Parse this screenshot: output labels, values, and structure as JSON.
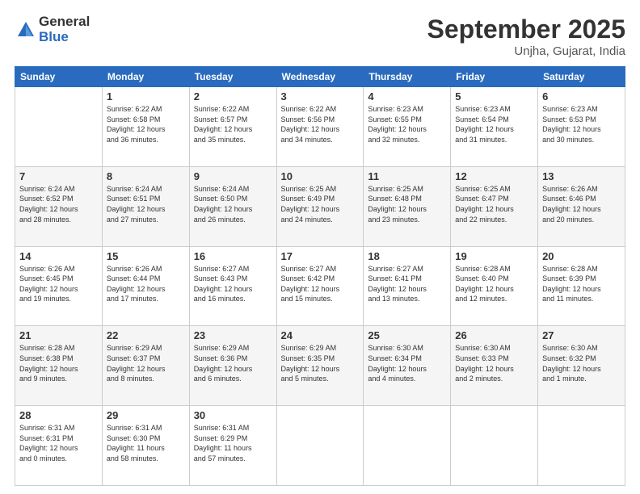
{
  "header": {
    "logo_general": "General",
    "logo_blue": "Blue",
    "month_title": "September 2025",
    "location": "Unjha, Gujarat, India"
  },
  "weekdays": [
    "Sunday",
    "Monday",
    "Tuesday",
    "Wednesday",
    "Thursday",
    "Friday",
    "Saturday"
  ],
  "weeks": [
    [
      {
        "day": "",
        "info": ""
      },
      {
        "day": "1",
        "info": "Sunrise: 6:22 AM\nSunset: 6:58 PM\nDaylight: 12 hours\nand 36 minutes."
      },
      {
        "day": "2",
        "info": "Sunrise: 6:22 AM\nSunset: 6:57 PM\nDaylight: 12 hours\nand 35 minutes."
      },
      {
        "day": "3",
        "info": "Sunrise: 6:22 AM\nSunset: 6:56 PM\nDaylight: 12 hours\nand 34 minutes."
      },
      {
        "day": "4",
        "info": "Sunrise: 6:23 AM\nSunset: 6:55 PM\nDaylight: 12 hours\nand 32 minutes."
      },
      {
        "day": "5",
        "info": "Sunrise: 6:23 AM\nSunset: 6:54 PM\nDaylight: 12 hours\nand 31 minutes."
      },
      {
        "day": "6",
        "info": "Sunrise: 6:23 AM\nSunset: 6:53 PM\nDaylight: 12 hours\nand 30 minutes."
      }
    ],
    [
      {
        "day": "7",
        "info": "Sunrise: 6:24 AM\nSunset: 6:52 PM\nDaylight: 12 hours\nand 28 minutes."
      },
      {
        "day": "8",
        "info": "Sunrise: 6:24 AM\nSunset: 6:51 PM\nDaylight: 12 hours\nand 27 minutes."
      },
      {
        "day": "9",
        "info": "Sunrise: 6:24 AM\nSunset: 6:50 PM\nDaylight: 12 hours\nand 26 minutes."
      },
      {
        "day": "10",
        "info": "Sunrise: 6:25 AM\nSunset: 6:49 PM\nDaylight: 12 hours\nand 24 minutes."
      },
      {
        "day": "11",
        "info": "Sunrise: 6:25 AM\nSunset: 6:48 PM\nDaylight: 12 hours\nand 23 minutes."
      },
      {
        "day": "12",
        "info": "Sunrise: 6:25 AM\nSunset: 6:47 PM\nDaylight: 12 hours\nand 22 minutes."
      },
      {
        "day": "13",
        "info": "Sunrise: 6:26 AM\nSunset: 6:46 PM\nDaylight: 12 hours\nand 20 minutes."
      }
    ],
    [
      {
        "day": "14",
        "info": "Sunrise: 6:26 AM\nSunset: 6:45 PM\nDaylight: 12 hours\nand 19 minutes."
      },
      {
        "day": "15",
        "info": "Sunrise: 6:26 AM\nSunset: 6:44 PM\nDaylight: 12 hours\nand 17 minutes."
      },
      {
        "day": "16",
        "info": "Sunrise: 6:27 AM\nSunset: 6:43 PM\nDaylight: 12 hours\nand 16 minutes."
      },
      {
        "day": "17",
        "info": "Sunrise: 6:27 AM\nSunset: 6:42 PM\nDaylight: 12 hours\nand 15 minutes."
      },
      {
        "day": "18",
        "info": "Sunrise: 6:27 AM\nSunset: 6:41 PM\nDaylight: 12 hours\nand 13 minutes."
      },
      {
        "day": "19",
        "info": "Sunrise: 6:28 AM\nSunset: 6:40 PM\nDaylight: 12 hours\nand 12 minutes."
      },
      {
        "day": "20",
        "info": "Sunrise: 6:28 AM\nSunset: 6:39 PM\nDaylight: 12 hours\nand 11 minutes."
      }
    ],
    [
      {
        "day": "21",
        "info": "Sunrise: 6:28 AM\nSunset: 6:38 PM\nDaylight: 12 hours\nand 9 minutes."
      },
      {
        "day": "22",
        "info": "Sunrise: 6:29 AM\nSunset: 6:37 PM\nDaylight: 12 hours\nand 8 minutes."
      },
      {
        "day": "23",
        "info": "Sunrise: 6:29 AM\nSunset: 6:36 PM\nDaylight: 12 hours\nand 6 minutes."
      },
      {
        "day": "24",
        "info": "Sunrise: 6:29 AM\nSunset: 6:35 PM\nDaylight: 12 hours\nand 5 minutes."
      },
      {
        "day": "25",
        "info": "Sunrise: 6:30 AM\nSunset: 6:34 PM\nDaylight: 12 hours\nand 4 minutes."
      },
      {
        "day": "26",
        "info": "Sunrise: 6:30 AM\nSunset: 6:33 PM\nDaylight: 12 hours\nand 2 minutes."
      },
      {
        "day": "27",
        "info": "Sunrise: 6:30 AM\nSunset: 6:32 PM\nDaylight: 12 hours\nand 1 minute."
      }
    ],
    [
      {
        "day": "28",
        "info": "Sunrise: 6:31 AM\nSunset: 6:31 PM\nDaylight: 12 hours\nand 0 minutes."
      },
      {
        "day": "29",
        "info": "Sunrise: 6:31 AM\nSunset: 6:30 PM\nDaylight: 11 hours\nand 58 minutes."
      },
      {
        "day": "30",
        "info": "Sunrise: 6:31 AM\nSunset: 6:29 PM\nDaylight: 11 hours\nand 57 minutes."
      },
      {
        "day": "",
        "info": ""
      },
      {
        "day": "",
        "info": ""
      },
      {
        "day": "",
        "info": ""
      },
      {
        "day": "",
        "info": ""
      }
    ]
  ]
}
